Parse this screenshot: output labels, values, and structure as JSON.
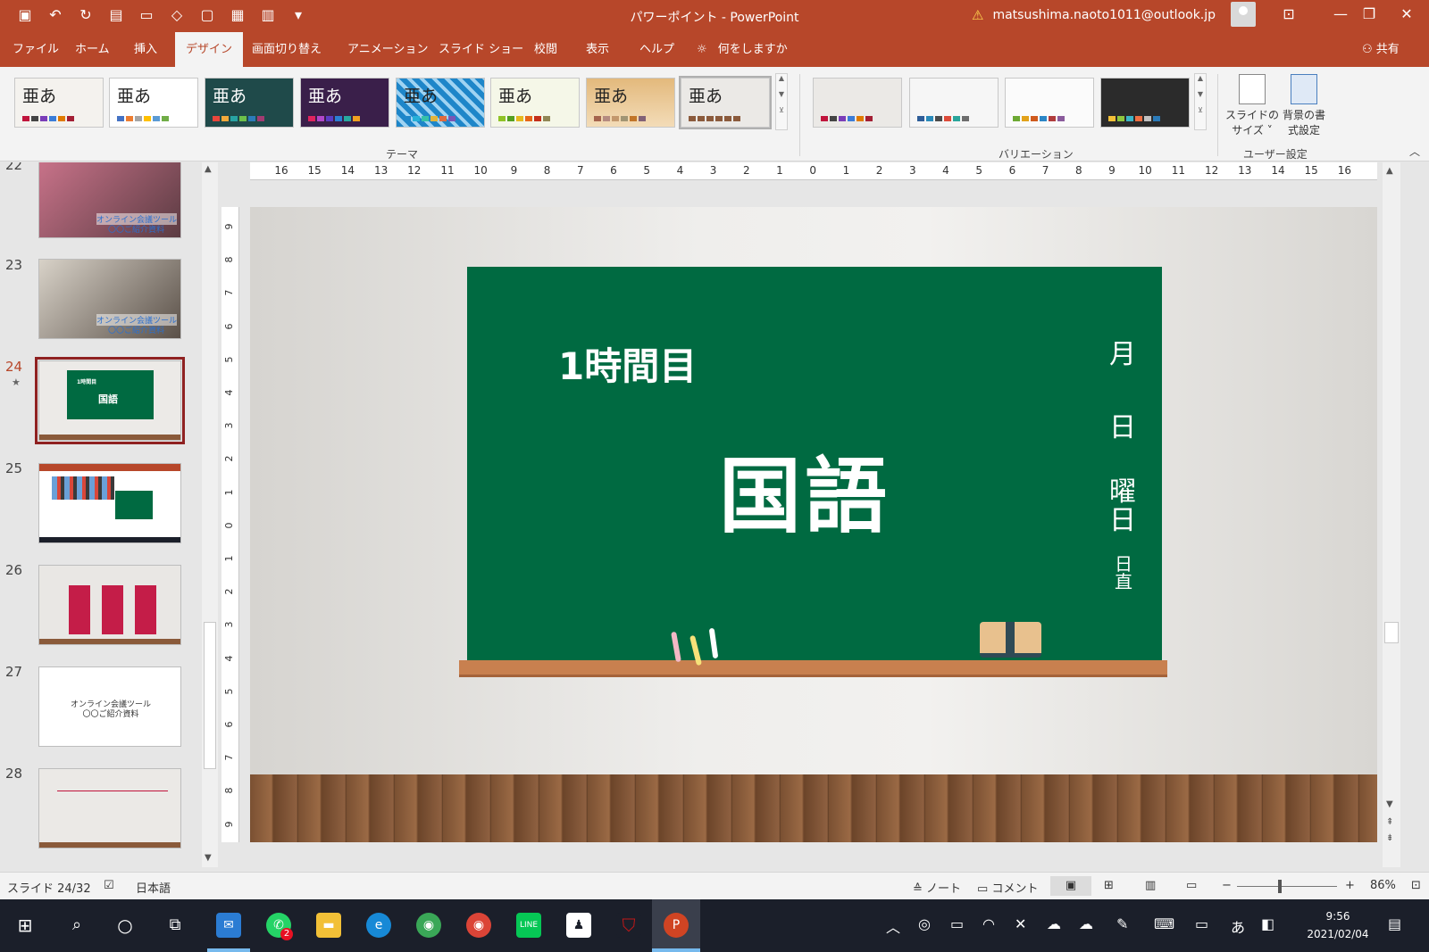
{
  "window": {
    "title": "パワーポイント  -  PowerPoint",
    "account": "matsushima.naoto1011@outlook.jp"
  },
  "tabs": [
    {
      "label": "ファイル"
    },
    {
      "label": "ホーム"
    },
    {
      "label": "挿入"
    },
    {
      "label": "デザイン"
    },
    {
      "label": "画面切り替え"
    },
    {
      "label": "アニメーション"
    },
    {
      "label": "スライド ショー"
    },
    {
      "label": "校閲"
    },
    {
      "label": "表示"
    },
    {
      "label": "ヘルプ"
    }
  ],
  "tellme": "何をしますか",
  "share": "共有",
  "ribbon": {
    "themes_label": "テーマ",
    "variations_label": "バリエーション",
    "customize_label": "ユーザー設定",
    "theme_text": "亜あ",
    "slide_size": "スライドの\nサイズ ˅",
    "background_format": "背景の書\n式設定"
  },
  "slides": [
    {
      "num": "22"
    },
    {
      "num": "23"
    },
    {
      "num": "24"
    },
    {
      "num": "25"
    },
    {
      "num": "26"
    },
    {
      "num": "27"
    },
    {
      "num": "28"
    }
  ],
  "thumb_texts": {
    "online_tool": "オンライン会議ツール",
    "intro": "〇〇ご紹介資料"
  },
  "slide": {
    "period": "1時間目",
    "subject": "国語",
    "month": "月",
    "day": "日",
    "weekday_a": "曜",
    "weekday_b": "日",
    "duty_a": "日",
    "duty_b": "直"
  },
  "ruler": {
    "h": [
      "16",
      "15",
      "14",
      "13",
      "12",
      "11",
      "10",
      "9",
      "8",
      "7",
      "6",
      "5",
      "4",
      "3",
      "2",
      "1",
      "0",
      "1",
      "2",
      "3",
      "4",
      "5",
      "6",
      "7",
      "8",
      "9",
      "10",
      "11",
      "12",
      "13",
      "14",
      "15",
      "16"
    ],
    "v": [
      "9",
      "8",
      "7",
      "6",
      "5",
      "4",
      "3",
      "2",
      "1",
      "0",
      "1",
      "2",
      "3",
      "4",
      "5",
      "6",
      "7",
      "8",
      "9"
    ]
  },
  "status": {
    "slide_count": "スライド 24/32",
    "language": "日本語",
    "notes": "ノート",
    "comments": "コメント",
    "zoom": "86%",
    "zoom_fraction": 0.43
  },
  "taskbar": {
    "time": "9:56",
    "date": "2021/02/04",
    "whatsapp_badge": "2",
    "ime": "あ"
  },
  "colors": {
    "accent": "#b7472a",
    "board": "#006a41"
  }
}
